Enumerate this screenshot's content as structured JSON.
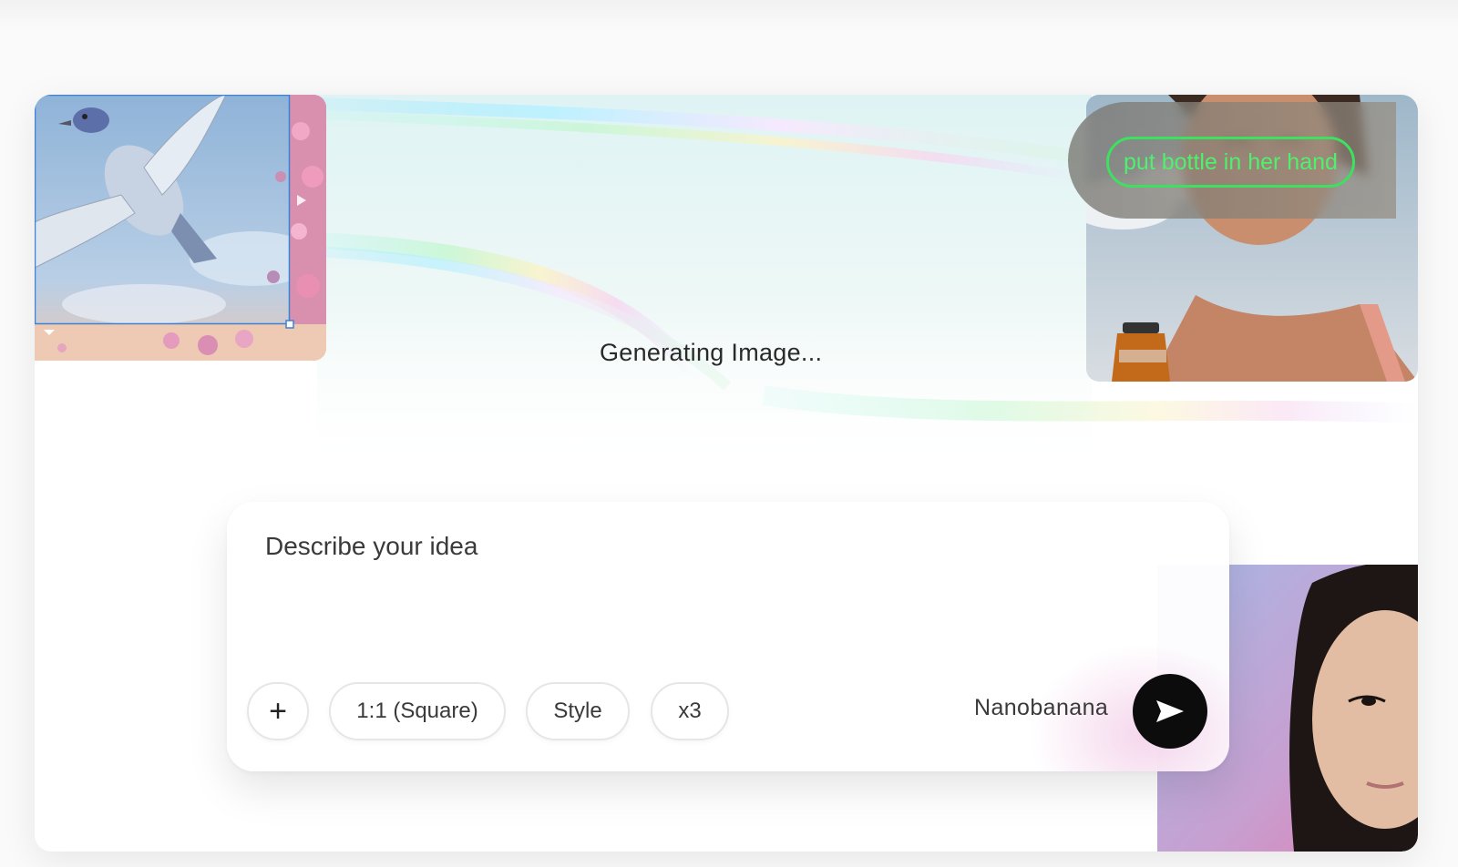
{
  "status": {
    "generating_text": "Generating Image..."
  },
  "edit_overlay": {
    "chip_text": "put bottle in her hand"
  },
  "prompt": {
    "placeholder": "Describe your idea",
    "value": ""
  },
  "toolbar": {
    "add_label": "+",
    "aspect_ratio_label": "1:1 (Square)",
    "style_label": "Style",
    "count_label": "x3",
    "model_label": "Nanobanana"
  },
  "colors": {
    "accent_green": "#3ee05f",
    "send_button": "#0c0c0c"
  },
  "icons": {
    "send": "send-arrow-icon",
    "add": "plus-icon"
  }
}
